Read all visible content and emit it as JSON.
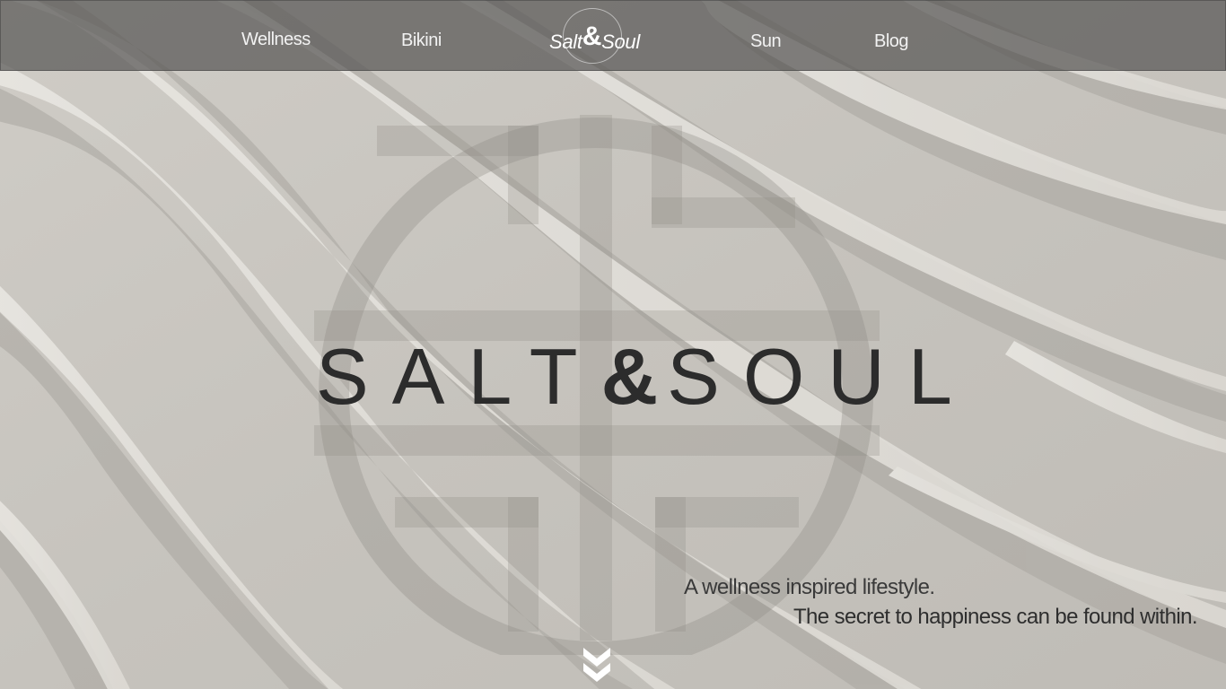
{
  "nav": {
    "links": [
      {
        "label": "Wellness"
      },
      {
        "label": "Bikini"
      },
      {
        "label": "Sun"
      },
      {
        "label": "Blog"
      }
    ],
    "logo": {
      "left": "Salt",
      "amp": "&",
      "right": "Soul"
    }
  },
  "hero": {
    "title_left": "SALT",
    "title_amp": "&",
    "title_right": "SOUL",
    "tagline_line1": "A wellness inspired lifestyle.",
    "tagline_line2": "The secret to happiness can be found within."
  },
  "icons": {
    "scroll": "double-chevron-down-icon",
    "watermark": "salt-and-soul-emblem"
  },
  "colors": {
    "nav_bg": "#585654",
    "sand": "#c9c6c0",
    "title_text": "#2c2c2c"
  }
}
